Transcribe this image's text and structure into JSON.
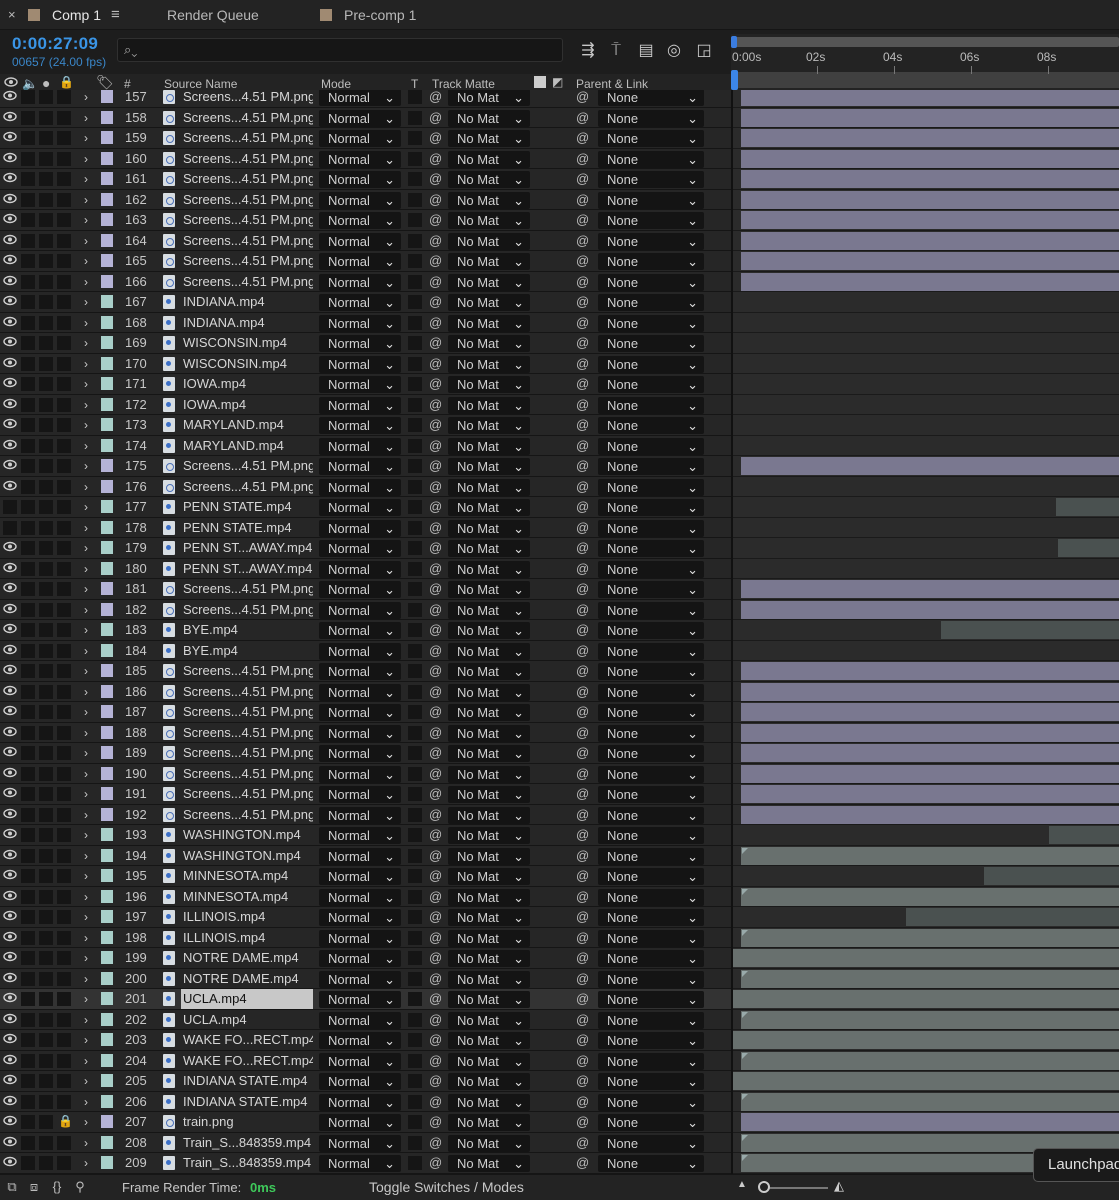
{
  "tabs": {
    "close_glyph": "×",
    "comp1": "Comp 1",
    "menu_glyph": "≡",
    "render_queue": "Render Queue",
    "precomp1": "Pre-comp 1"
  },
  "timecode": "0:00:27:09",
  "frame_info": "00657 (24.00 fps)",
  "search": {
    "placeholder": ""
  },
  "ruler_labels": [
    "0:00s",
    "02s",
    "04s",
    "06s",
    "08s"
  ],
  "columns": {
    "number": "#",
    "source_name": "Source Name",
    "mode": "Mode",
    "t": "T",
    "track_matte": "Track Matte",
    "parent_link": "Parent & Link"
  },
  "layers": [
    {
      "n": "157",
      "name": "Screens...4.51 PM.png",
      "type": "png",
      "eye": true,
      "bar": "lav"
    },
    {
      "n": "158",
      "name": "Screens...4.51 PM.png",
      "type": "png",
      "eye": true,
      "bar": "lav"
    },
    {
      "n": "159",
      "name": "Screens...4.51 PM.png",
      "type": "png",
      "eye": true,
      "bar": "lav"
    },
    {
      "n": "160",
      "name": "Screens...4.51 PM.png",
      "type": "png",
      "eye": true,
      "bar": "lav"
    },
    {
      "n": "161",
      "name": "Screens...4.51 PM.png",
      "type": "png",
      "eye": true,
      "bar": "lav"
    },
    {
      "n": "162",
      "name": "Screens...4.51 PM.png",
      "type": "png",
      "eye": true,
      "bar": "lav"
    },
    {
      "n": "163",
      "name": "Screens...4.51 PM.png",
      "type": "png",
      "eye": true,
      "bar": "lav"
    },
    {
      "n": "164",
      "name": "Screens...4.51 PM.png",
      "type": "png",
      "eye": true,
      "bar": "lav"
    },
    {
      "n": "165",
      "name": "Screens...4.51 PM.png",
      "type": "png",
      "eye": true,
      "bar": "lav"
    },
    {
      "n": "166",
      "name": "Screens...4.51 PM.png",
      "type": "png",
      "eye": true,
      "bar": "lav"
    },
    {
      "n": "167",
      "name": "INDIANA.mp4",
      "type": "mp4",
      "eye": true,
      "bar": "none"
    },
    {
      "n": "168",
      "name": "INDIANA.mp4",
      "type": "mp4",
      "eye": true,
      "bar": "none"
    },
    {
      "n": "169",
      "name": "WISCONSIN.mp4",
      "type": "mp4",
      "eye": true,
      "bar": "none"
    },
    {
      "n": "170",
      "name": "WISCONSIN.mp4",
      "type": "mp4",
      "eye": true,
      "bar": "none"
    },
    {
      "n": "171",
      "name": "IOWA.mp4",
      "type": "mp4",
      "eye": true,
      "bar": "none"
    },
    {
      "n": "172",
      "name": "IOWA.mp4",
      "type": "mp4",
      "eye": true,
      "bar": "none"
    },
    {
      "n": "173",
      "name": "MARYLAND.mp4",
      "type": "mp4",
      "eye": true,
      "bar": "none"
    },
    {
      "n": "174",
      "name": "MARYLAND.mp4",
      "type": "mp4",
      "eye": true,
      "bar": "none"
    },
    {
      "n": "175",
      "name": "Screens...4.51 PM.png",
      "type": "png",
      "eye": true,
      "bar": "lav"
    },
    {
      "n": "176",
      "name": "Screens...4.51 PM.png",
      "type": "png",
      "eye": true,
      "bar": "none"
    },
    {
      "n": "177",
      "name": "PENN STATE.mp4",
      "type": "mp4",
      "eye": false,
      "bar": "dim-late"
    },
    {
      "n": "178",
      "name": "PENN STATE.mp4",
      "type": "mp4",
      "eye": false,
      "bar": "none"
    },
    {
      "n": "179",
      "name": "PENN ST...AWAY.mp4",
      "type": "mp4",
      "eye": true,
      "bar": "dim-late2"
    },
    {
      "n": "180",
      "name": "PENN ST...AWAY.mp4",
      "type": "mp4",
      "eye": true,
      "bar": "none"
    },
    {
      "n": "181",
      "name": "Screens...4.51 PM.png",
      "type": "png",
      "eye": true,
      "bar": "lav"
    },
    {
      "n": "182",
      "name": "Screens...4.51 PM.png",
      "type": "png",
      "eye": true,
      "bar": "lav"
    },
    {
      "n": "183",
      "name": "BYE.mp4",
      "type": "mp4",
      "eye": true,
      "bar": "dim-mid"
    },
    {
      "n": "184",
      "name": "BYE.mp4",
      "type": "mp4",
      "eye": true,
      "bar": "none"
    },
    {
      "n": "185",
      "name": "Screens...4.51 PM.png",
      "type": "png",
      "eye": true,
      "bar": "lav"
    },
    {
      "n": "186",
      "name": "Screens...4.51 PM.png",
      "type": "png",
      "eye": true,
      "bar": "lav"
    },
    {
      "n": "187",
      "name": "Screens...4.51 PM.png",
      "type": "png",
      "eye": true,
      "bar": "lav"
    },
    {
      "n": "188",
      "name": "Screens...4.51 PM.png",
      "type": "png",
      "eye": true,
      "bar": "lav"
    },
    {
      "n": "189",
      "name": "Screens...4.51 PM.png",
      "type": "png",
      "eye": true,
      "bar": "lav"
    },
    {
      "n": "190",
      "name": "Screens...4.51 PM.png",
      "type": "png",
      "eye": true,
      "bar": "lav"
    },
    {
      "n": "191",
      "name": "Screens...4.51 PM.png",
      "type": "png",
      "eye": true,
      "bar": "lav"
    },
    {
      "n": "192",
      "name": "Screens...4.51 PM.png",
      "type": "png",
      "eye": true,
      "bar": "lav"
    },
    {
      "n": "193",
      "name": "WASHINGTON.mp4",
      "type": "mp4",
      "eye": true,
      "bar": "dim-late3"
    },
    {
      "n": "194",
      "name": "WASHINGTON.mp4",
      "type": "mp4",
      "eye": true,
      "bar": "teal"
    },
    {
      "n": "195",
      "name": "MINNESOTA.mp4",
      "type": "mp4",
      "eye": true,
      "bar": "dim-mid2"
    },
    {
      "n": "196",
      "name": "MINNESOTA.mp4",
      "type": "mp4",
      "eye": true,
      "bar": "teal"
    },
    {
      "n": "197",
      "name": "ILLINOIS.mp4",
      "type": "mp4",
      "eye": true,
      "bar": "dim-mid3"
    },
    {
      "n": "198",
      "name": "ILLINOIS.mp4",
      "type": "mp4",
      "eye": true,
      "bar": "teal"
    },
    {
      "n": "199",
      "name": "NOTRE DAME.mp4",
      "type": "mp4",
      "eye": true,
      "bar": "teal-full"
    },
    {
      "n": "200",
      "name": "NOTRE DAME.mp4",
      "type": "mp4",
      "eye": true,
      "bar": "teal"
    },
    {
      "n": "201",
      "name": "UCLA.mp4",
      "type": "mp4",
      "eye": true,
      "bar": "teal-full",
      "selected": true
    },
    {
      "n": "202",
      "name": "UCLA.mp4",
      "type": "mp4",
      "eye": true,
      "bar": "teal"
    },
    {
      "n": "203",
      "name": "WAKE FO...RECT.mp4",
      "type": "mp4",
      "eye": true,
      "bar": "teal-full"
    },
    {
      "n": "204",
      "name": "WAKE FO...RECT.mp4",
      "type": "mp4",
      "eye": true,
      "bar": "teal"
    },
    {
      "n": "205",
      "name": "INDIANA STATE.mp4",
      "type": "mp4",
      "eye": true,
      "bar": "teal-full"
    },
    {
      "n": "206",
      "name": "INDIANA STATE.mp4",
      "type": "mp4",
      "eye": true,
      "bar": "teal"
    },
    {
      "n": "207",
      "name": "train.png",
      "type": "png",
      "eye": true,
      "bar": "lav",
      "locked": true
    },
    {
      "n": "208",
      "name": "Train_S...848359.mp4",
      "type": "mp4",
      "eye": true,
      "bar": "teal"
    },
    {
      "n": "209",
      "name": "Train_S...848359.mp4",
      "type": "mp4",
      "eye": true,
      "bar": "teal"
    }
  ],
  "defaults": {
    "mode": "Normal",
    "track_matte": "No Mat",
    "parent": "None"
  },
  "bottom": {
    "frame_render_label": "Frame Render Time:",
    "frame_render_value": "0ms",
    "toggle_label": "Toggle Switches / Modes"
  },
  "tooltip": "Launchpad",
  "colors": {
    "timecode": "#3a95e6",
    "png_label": "#b5b3d6",
    "mp4_label": "#a9cfc9",
    "render_time": "#3ec85a",
    "track_lavender": "#7a7890",
    "track_teal": "#68706e"
  }
}
